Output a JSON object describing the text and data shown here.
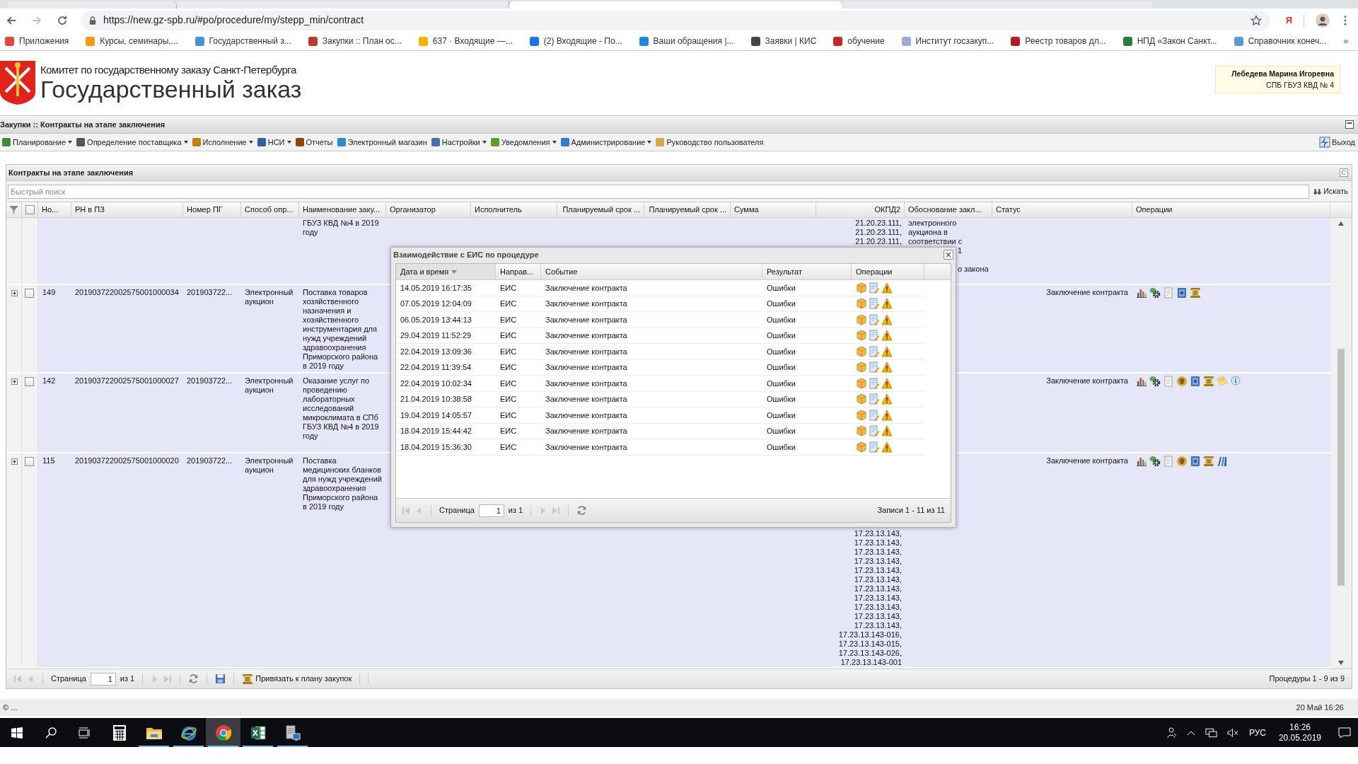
{
  "browser": {
    "address": "https://new.gz-spb.ru/#po/procedure/my/stepp_min/contract",
    "extension": "Я",
    "more": "»",
    "bookmarks": [
      {
        "label": "Приложения",
        "color": "#e8453c"
      },
      {
        "label": "Курсы, семинары,...",
        "color": "#f39c12"
      },
      {
        "label": "Государственный з...",
        "color": "#4a90d9"
      },
      {
        "label": "Закупки :: План ос...",
        "color": "#c0392b"
      },
      {
        "label": "637 · Входящие —...",
        "color": "#f4b400"
      },
      {
        "label": "(2) Входящие - По...",
        "color": "#1a73e8"
      },
      {
        "label": "Ваши обращения |...",
        "color": "#1e88e5"
      },
      {
        "label": "Заявки | КИС",
        "color": "#444444"
      },
      {
        "label": "обучение",
        "color": "#c62828"
      },
      {
        "label": "Институт госзакуп...",
        "color": "#9fa8da"
      },
      {
        "label": "Реестр товаров дл...",
        "color": "#b71c1c"
      },
      {
        "label": "НПД «Закон Санкт...",
        "color": "#2e7d32"
      },
      {
        "label": "Справочник конеч...",
        "color": "#5b9bd5"
      }
    ]
  },
  "header": {
    "org": "Комитет по государственному заказу Санкт-Петербурга",
    "title": "Государственный заказ",
    "user": {
      "name": "Лебедева Марина Игоревна",
      "org": "СПБ ГБУЗ КВД № 4"
    }
  },
  "breadcrumb": "Закупки :: Контракты на этапе заключения",
  "menu": [
    {
      "label": "Планирование",
      "dropdown": true,
      "color": "#3d8b3d"
    },
    {
      "label": "Определение поставщика",
      "dropdown": true,
      "color": "#555555"
    },
    {
      "label": "Исполнение",
      "dropdown": true,
      "color": "#b8860b"
    },
    {
      "label": "НСИ",
      "dropdown": true,
      "color": "#2f5fa8"
    },
    {
      "label": "Отчеты",
      "dropdown": false,
      "color": "#8b4513"
    },
    {
      "label": "Электронный магазин",
      "dropdown": false,
      "color": "#2a8ad4"
    },
    {
      "label": "Настройки",
      "dropdown": true,
      "color": "#4a6fa5"
    },
    {
      "label": "Уведомления",
      "dropdown": true,
      "color": "#5aa02c"
    },
    {
      "label": "Администрирование",
      "dropdown": true,
      "color": "#2f7fd0"
    },
    {
      "label": "Руководство пользователя",
      "dropdown": false,
      "color": "#d4a94a"
    }
  ],
  "logout": "Выход",
  "panel": {
    "title": "Контракты на этапе заключения",
    "search": {
      "placeholder": "Быстрый поиск",
      "button": "Искать"
    },
    "header_checkbox": {
      "checked": false
    },
    "columns": [
      "Но...",
      "РН в ПЗ",
      "Номер ПГ",
      "Способ опр...",
      "Наименование заку...",
      "Организатор",
      "Исполнитель",
      "Планируемый срок ...",
      "Планируемый срок ...",
      "Сумма",
      "ОКПД2",
      "Обоснование закл...",
      "Статус",
      "Операции"
    ],
    "rows": [
      {
        "name": "ГБУЗ КВД №4 в 2019 году",
        "okpd": [
          "21.20.23.111,",
          "21.20.23.111,",
          "21.20.23.111,"
        ],
        "basis": [
          "электронного",
          "аукциона в",
          "соответствии с"
        ],
        "basis_fragments": [
          "1",
          "о закона"
        ]
      },
      {
        "expanded": false,
        "checked": false,
        "number": "149",
        "rn": "201903722002575001000034",
        "pg": "201903722...",
        "method": "Электронный аукцион",
        "name": "Поставка товаров хозяйственного назначения и хозяйственного инструментария для нужд учреждений здравоохранения Приморского района в 2019 году",
        "status": "Заключение контракта",
        "operations": [
          {
            "kind": "chart"
          },
          {
            "kind": "gear"
          },
          {
            "kind": "document"
          },
          {
            "kind": "book"
          },
          {
            "kind": "scroll"
          }
        ]
      },
      {
        "expanded": false,
        "checked": false,
        "number": "142",
        "rn": "201903722002575001000027",
        "pg": "201903722...",
        "method": "Электронный аукцион",
        "name": "Оказание услуг по проведению лабораторных исследований микроклимата в СПб ГБУЗ КВД №4 в 2019 году",
        "status": "Заключение контракта",
        "operations": [
          {
            "kind": "chart"
          },
          {
            "kind": "gear"
          },
          {
            "kind": "document"
          },
          {
            "kind": "emblem"
          },
          {
            "kind": "book"
          },
          {
            "kind": "scroll"
          },
          {
            "kind": "note"
          },
          {
            "kind": "info"
          }
        ]
      },
      {
        "expanded": false,
        "checked": false,
        "number": "115",
        "rn": "201903722002575001000020",
        "pg": "201903722...",
        "method": "Электронный аукцион",
        "name": "Поставка медицинских бланков для нужд учреждений здравоохранения Приморского района в 2019 году",
        "okpd": [
          "17.23.13.143,",
          "17.23.13.143,",
          "17.23.13.143,",
          "17.23.13.143,",
          "17.23.13.143,",
          "17.23.13.143,",
          "17.23.13.143,",
          "17.23.13.143,",
          "17.23.13.143,",
          "17.23.13.143,",
          "17.23.13.143,",
          "17.23.13.143-016,",
          "17.23.13.143-015,",
          "17.23.13.143-026,",
          "17.23.13.143-001"
        ],
        "status": "Заключение контракта",
        "operations": [
          {
            "kind": "chart"
          },
          {
            "kind": "gear"
          },
          {
            "kind": "document"
          },
          {
            "kind": "emblem"
          },
          {
            "kind": "book"
          },
          {
            "kind": "scroll"
          },
          {
            "kind": "binders"
          }
        ]
      }
    ],
    "pager": {
      "page_label": "Страница",
      "page": "1",
      "of": "из 1",
      "bind": "Привязать к плану закупок",
      "summary": "Процедуры 1 - 9 из 9"
    }
  },
  "dialog": {
    "title": "Взаимодействие с ЕИС по процедуре",
    "columns": [
      {
        "label": "Дата и время",
        "sorted": true
      },
      {
        "label": "Направ...",
        "sorted": false
      },
      {
        "label": "Событие",
        "sorted": false
      },
      {
        "label": "Результат",
        "sorted": false
      },
      {
        "label": "Операции",
        "sorted": false
      }
    ],
    "rows": [
      {
        "date": "14.05.2019 16:17:35",
        "direction": "ЕИС",
        "event": "Заключение контракта",
        "result": "Ошибки"
      },
      {
        "date": "07.05.2019 12:04:09",
        "direction": "ЕИС",
        "event": "Заключение контракта",
        "result": "Ошибки"
      },
      {
        "date": "06.05.2019 13:44:13",
        "direction": "ЕИС",
        "event": "Заключение контракта",
        "result": "Ошибки"
      },
      {
        "date": "29.04.2019 11:52:29",
        "direction": "ЕИС",
        "event": "Заключение контракта",
        "result": "Ошибки"
      },
      {
        "date": "22.04.2019 13:09:36",
        "direction": "ЕИС",
        "event": "Заключение контракта",
        "result": "Ошибки"
      },
      {
        "date": "22.04.2019 11:39:54",
        "direction": "ЕИС",
        "event": "Заключение контракта",
        "result": "Ошибки"
      },
      {
        "date": "22.04.2019 10:02:34",
        "direction": "ЕИС",
        "event": "Заключение контракта",
        "result": "Ошибки"
      },
      {
        "date": "21.04.2019 10:38:58",
        "direction": "ЕИС",
        "event": "Заключение контракта",
        "result": "Ошибки"
      },
      {
        "date": "19.04.2019 14:05:57",
        "direction": "ЕИС",
        "event": "Заключение контракта",
        "result": "Ошибки"
      },
      {
        "date": "18.04.2019 15:44:42",
        "direction": "ЕИС",
        "event": "Заключение контракта",
        "result": "Ошибки"
      },
      {
        "date": "18.04.2019 15:36:30",
        "direction": "ЕИС",
        "event": "Заключение контракта",
        "result": "Ошибки"
      }
    ],
    "pager": {
      "page_label": "Страница",
      "page": "1",
      "of": "из 1",
      "summary": "Записи 1 - 11 из 11"
    }
  },
  "status_bar": {
    "left": "© ...",
    "right": "20 Май 16:26"
  },
  "taskbar": {
    "apps": [
      {
        "kind": "calculator",
        "running": false,
        "active": false
      },
      {
        "kind": "folder",
        "running": true,
        "active": false
      },
      {
        "kind": "ie",
        "running": true,
        "active": false
      },
      {
        "kind": "chrome",
        "running": true,
        "active": true
      },
      {
        "kind": "excel",
        "running": true,
        "active": false
      },
      {
        "kind": "server",
        "running": true,
        "active": false
      }
    ],
    "lang": "РУС",
    "time": "16:26",
    "date": "20.05.2019"
  }
}
